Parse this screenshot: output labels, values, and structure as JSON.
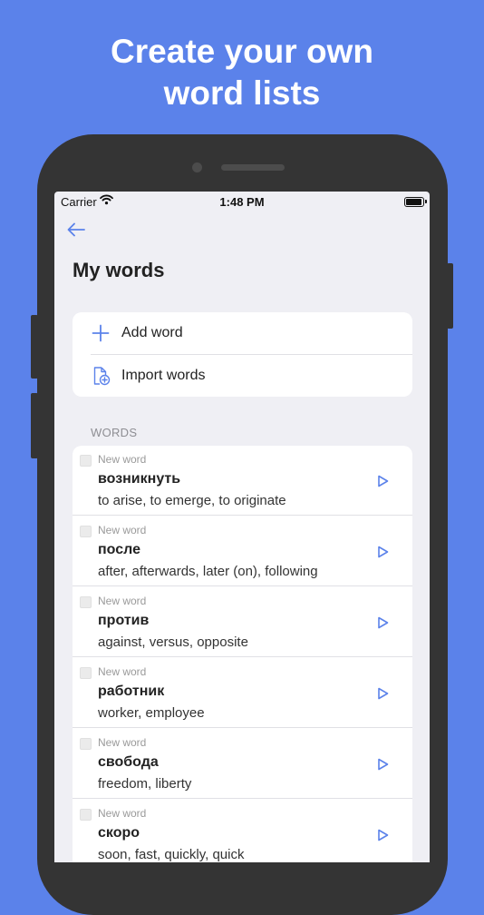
{
  "promo": {
    "line1": "Create your own",
    "line2": "word lists"
  },
  "status_bar": {
    "carrier": "Carrier",
    "time": "1:48 PM"
  },
  "page": {
    "title": "My words"
  },
  "actions": {
    "add_word": "Add word",
    "import_words": "Import words"
  },
  "words_section": {
    "label": "WORDS",
    "items": [
      {
        "status": "New word",
        "term": "возникнуть",
        "translation": "to arise, to emerge, to originate"
      },
      {
        "status": "New word",
        "term": "после",
        "translation": "after, afterwards, later (on), following"
      },
      {
        "status": "New word",
        "term": "против",
        "translation": "against, versus, opposite"
      },
      {
        "status": "New word",
        "term": "работник",
        "translation": "worker, employee"
      },
      {
        "status": "New word",
        "term": "свобода",
        "translation": "freedom, liberty"
      },
      {
        "status": "New word",
        "term": "скоро",
        "translation": "soon, fast, quickly, quick"
      }
    ]
  },
  "colors": {
    "background": "#5b82ea",
    "accent": "#5b82ea",
    "phone_frame": "#343434",
    "screen_bg": "#efeff4"
  }
}
